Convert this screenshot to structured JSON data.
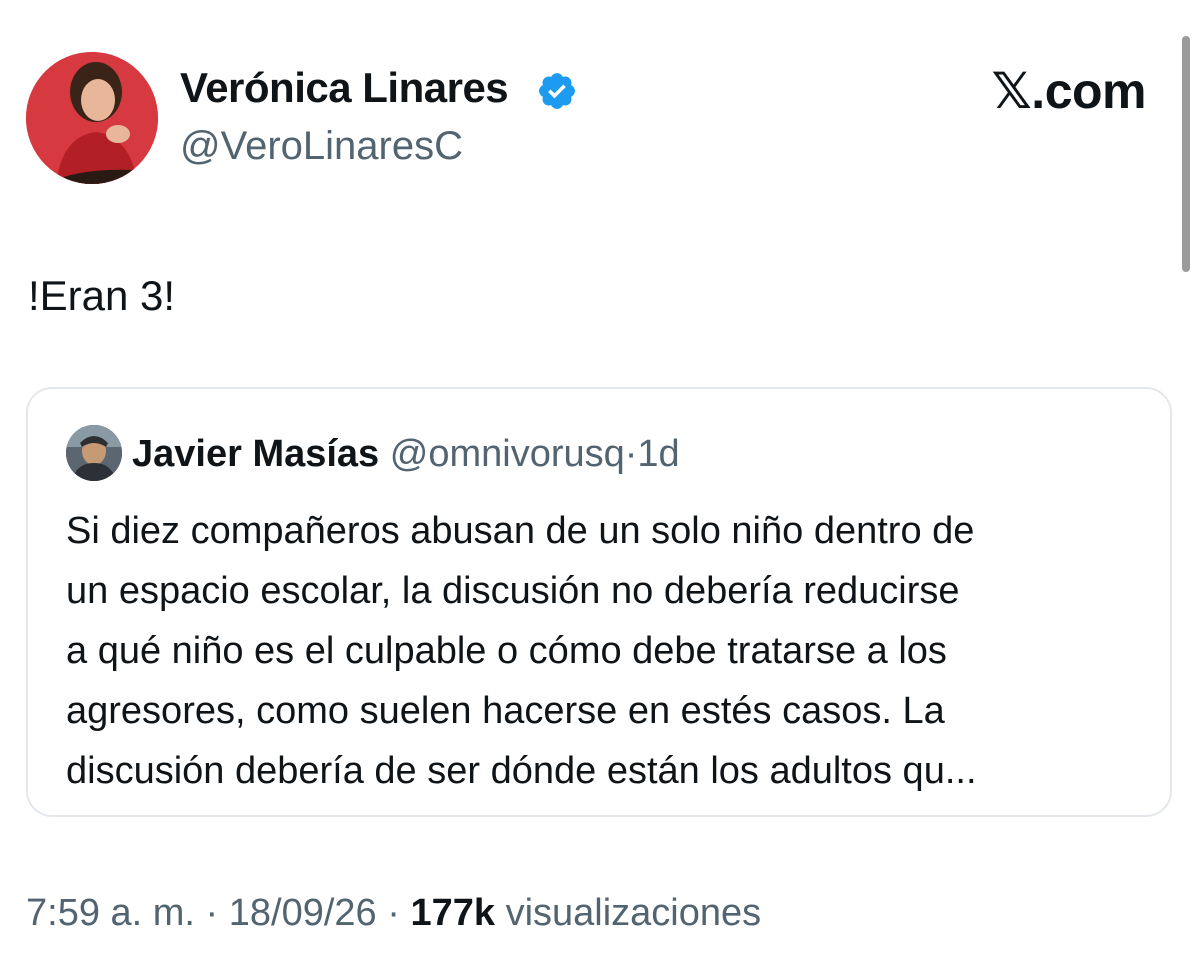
{
  "author": {
    "name": "Verónica Linares",
    "handle": "@VeroLinaresC",
    "verified": true
  },
  "site_logo": "𝕏.com",
  "tweet": {
    "text": "!Eran 3!"
  },
  "quote": {
    "name": "Javier Masías",
    "handle": "@omnivorusq",
    "separator": "·",
    "time": "1d",
    "lines": [
      "Si diez compañeros abusan de un solo niño dentro de",
      "un espacio escolar, la discusión no debería reducirse",
      "a qué niño es el culpable o cómo debe tratarse a los",
      "agresores, como suelen hacerse en estés casos. La",
      "discusión debería de ser dónde están los adultos qu..."
    ]
  },
  "meta": {
    "time": "7:59 a. m.",
    "separator": "·",
    "date": "18/09/26",
    "views_count": "177k",
    "views_label": "visualizaciones"
  },
  "icons": {
    "verified": "verified-badge-icon",
    "avatar": "avatar",
    "quote_avatar": "avatar"
  },
  "colors": {
    "verified_blue": "#1d9bf0",
    "secondary_text": "#536471",
    "primary_text": "#0f1419",
    "border": "#e4e8ec"
  }
}
